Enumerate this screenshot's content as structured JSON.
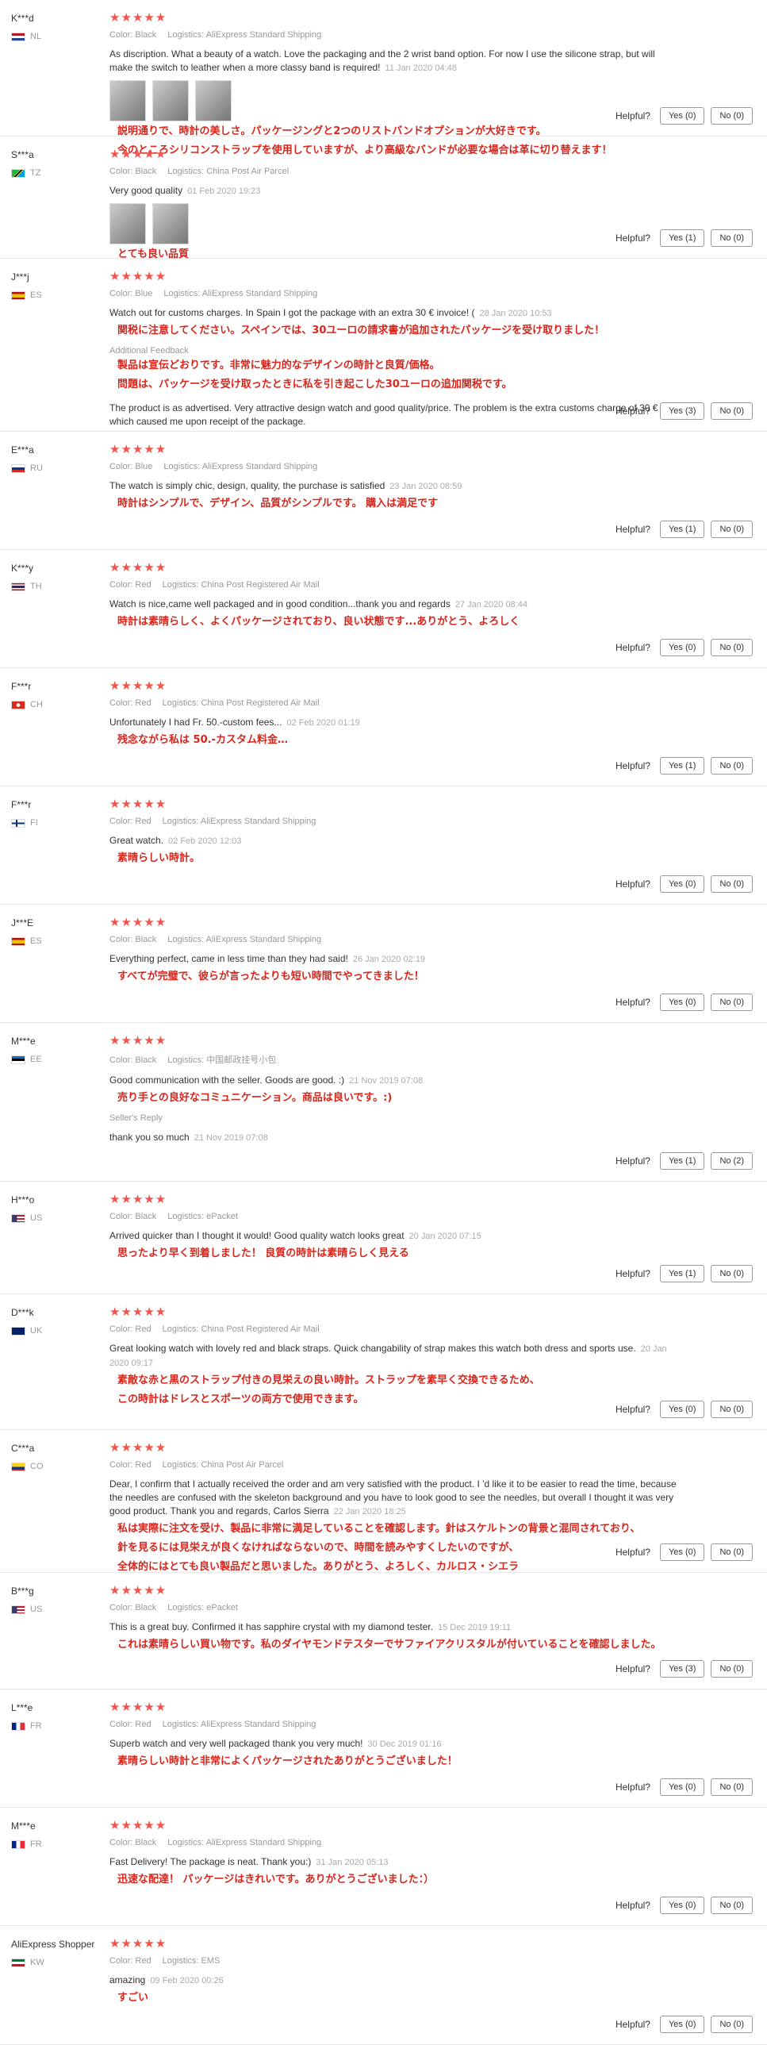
{
  "reviews": [
    {
      "user": "K***d",
      "country": "NL",
      "stars": "★★★★★",
      "color": "Color: Black",
      "logistics": "Logistics: AliExpress Standard Shipping",
      "text": "As discription. What a beauty of a watch. Love the packaging and the 2 wrist band option. For now I use the silicone strap, but will make the switch to leather when a more classy band is required!",
      "date": "11 Jan 2020 04:48",
      "jp": [
        "説明通りで、時計の美しさ。パッケージングと2つのリストバンドオプションが大好きです。",
        "今のところシリコンストラップを使用していますが、より高級なバンドが必要な場合は革に切り替えます！"
      ],
      "yes": "Yes (0)",
      "no": "No (0)"
    },
    {
      "user": "S***a",
      "country": "TZ",
      "stars": "★★★★★",
      "color": "Color: Black",
      "logistics": "Logistics: China Post Air Parcel",
      "text": "Very good quality",
      "date": "01 Feb 2020 19:23",
      "jp": [
        "とても良い品質"
      ],
      "yes": "Yes (1)",
      "no": "No (0)"
    },
    {
      "user": "J***j",
      "country": "ES",
      "stars": "★★★★★",
      "color": "Color: Blue",
      "logistics": "Logistics: AliExpress Standard Shipping",
      "text": "Watch out for customs charges. In Spain I got the package with an extra 30 € invoice! (",
      "date": "28 Jan 2020 10:53",
      "jp": [
        "関税に注意してください。スペインでは、30ユーロの請求書が追加されたパッケージを受け取りました！"
      ],
      "additional_label": "Additional Feedback",
      "additional_jp": [
        "製品は宣伝どおりです。非常に魅力的なデザインの時計と良質/価格。",
        "問題は、パッケージを受け取ったときに私を引き起こした30ユーロの追加関税です。"
      ],
      "additional_text": "The product is as advertised. Very attractive design watch and good quality/price. The problem is the extra customs charge of 30 € which caused me upon receipt of the package.",
      "yes": "Yes (3)",
      "no": "No (0)"
    },
    {
      "user": "E***a",
      "country": "RU",
      "stars": "★★★★★",
      "color": "Color: Blue",
      "logistics": "Logistics: AliExpress Standard Shipping",
      "text": "The watch is simply chic, design, quality, the purchase is satisfied",
      "date": "23 Jan 2020 08:59",
      "jp": [
        "時計はシンプルで、デザイン、品質がシンプルです。 購入は満足です"
      ],
      "yes": "Yes (1)",
      "no": "No (0)"
    },
    {
      "user": "K***y",
      "country": "TH",
      "stars": "★★★★★",
      "color": "Color: Red",
      "logistics": "Logistics: China Post Registered Air Mail",
      "text": "Watch is nice,came well packaged and in good condition...thank you and regards",
      "date": "27 Jan 2020 08:44",
      "jp": [
        "時計は素晴らしく、よくパッケージされており、良い状態です...ありがとう、よろしく"
      ],
      "yes": "Yes (0)",
      "no": "No (0)"
    },
    {
      "user": "F***r",
      "country": "CH",
      "stars": "★★★★★",
      "color": "Color: Red",
      "logistics": "Logistics: China Post Registered Air Mail",
      "text": "Unfortunately I had Fr. 50.-custom fees...",
      "date": "02 Feb 2020 01:19",
      "jp": [
        "残念ながら私は 50.-カスタム料金…"
      ],
      "yes": "Yes (1)",
      "no": "No (0)"
    },
    {
      "user": "F***r",
      "country": "FI",
      "stars": "★★★★★",
      "color": "Color: Red",
      "logistics": "Logistics: AliExpress Standard Shipping",
      "text": "Great watch.",
      "date": "02 Feb 2020 12:03",
      "jp": [
        "素晴らしい時計。"
      ],
      "yes": "Yes (0)",
      "no": "No (0)"
    },
    {
      "user": "J***E",
      "country": "ES",
      "stars": "★★★★★",
      "color": "Color: Black",
      "logistics": "Logistics: AliExpress Standard Shipping",
      "text": "Everything perfect, came in less time than they had said!",
      "date": "26 Jan 2020 02:19",
      "jp": [
        "すべてが完璧で、彼らが言ったよりも短い時間でやってきました！"
      ],
      "yes": "Yes (0)",
      "no": "No (0)"
    },
    {
      "user": "M***e",
      "country": "EE",
      "stars": "★★★★★",
      "color": "Color: Black",
      "logistics": "Logistics: 中国邮政挂号小包",
      "text": "Good communication with the seller. Goods are good. :)",
      "date": "21 Nov 2019 07:08",
      "jp": [
        "売り手との良好なコミュニケーション。商品は良いです。:)"
      ],
      "seller_label": "Seller's Reply",
      "seller_text": "thank you so much",
      "seller_date": "21 Nov 2019 07:08",
      "yes": "Yes (1)",
      "no": "No (2)"
    },
    {
      "user": "H***o",
      "country": "US",
      "stars": "★★★★★",
      "color": "Color: Black",
      "logistics": "Logistics: ePacket",
      "text": "Arrived quicker than I thought it would! Good quality watch looks great",
      "date": "20 Jan 2020 07:15",
      "jp": [
        "思ったより早く到着しました！ 良質の時計は素晴らしく見える"
      ],
      "yes": "Yes (1)",
      "no": "No (0)"
    },
    {
      "user": "D***k",
      "country": "UK",
      "stars": "★★★★★",
      "color": "Color: Red",
      "logistics": "Logistics: China Post Registered Air Mail",
      "text": "Great looking watch with lovely red and black straps. Quick changability of strap makes this watch both dress and sports use.",
      "date": "20 Jan 2020 09:17",
      "jp": [
        "素敵な赤と黒のストラップ付きの見栄えの良い時計。ストラップを素早く交換できるため、",
        "この時計はドレスとスポーツの両方で使用できます。"
      ],
      "yes": "Yes (0)",
      "no": "No (0)"
    },
    {
      "user": "C***a",
      "country": "CO",
      "stars": "★★★★★",
      "color": "Color: Red",
      "logistics": "Logistics: China Post Air Parcel",
      "text": "Dear, I confirm that I actually received the order and am very satisfied with the product. I 'd like it to be easier to read the time, because the needles are confused with the skeleton background and you have to look good to see the needles, but overall I thought it was very good product. Thank you and regards, Carlos Sierra",
      "date": "22 Jan 2020 18:25",
      "jp": [
        "私は実際に注文を受け、製品に非常に満足していることを確認します。針はスケルトンの背景と混同されており、",
        "針を見るには見栄えが良くなければならないので、時間を読みやすくしたいのですが、",
        "全体的にはとても良い製品だと思いました。ありがとう、よろしく、カルロス・シエラ"
      ],
      "yes": "Yes (0)",
      "no": "No (0)"
    },
    {
      "user": "B***g",
      "country": "US",
      "stars": "★★★★★",
      "color": "Color: Black",
      "logistics": "Logistics: ePacket",
      "text": "This is a great buy. Confirmed it has sapphire crystal with my diamond tester.",
      "date": "15 Dec 2019 19:11",
      "jp": [
        "これは素晴らしい買い物です。私のダイヤモンドテスターでサファイアクリスタルが付いていることを確認しました。"
      ],
      "yes": "Yes (3)",
      "no": "No (0)"
    },
    {
      "user": "L***e",
      "country": "FR",
      "stars": "★★★★★",
      "color": "Color: Red",
      "logistics": "Logistics: AliExpress Standard Shipping",
      "text": "Superb watch and very well packaged thank you very much!",
      "date": "30 Dec 2019 01:16",
      "jp": [
        "素晴らしい時計と非常によくパッケージされたありがとうございました！"
      ],
      "yes": "Yes (0)",
      "no": "No (0)"
    },
    {
      "user": "M***e",
      "country": "FR",
      "stars": "★★★★★",
      "color": "Color: Black",
      "logistics": "Logistics: AliExpress Standard Shipping",
      "text": "Fast Delivery! The package is neat. Thank you:)",
      "date": "31 Jan 2020 05:13",
      "jp": [
        "迅速な配達！ パッケージはきれいです。ありがとうございました：）"
      ],
      "yes": "Yes (0)",
      "no": "No (0)"
    },
    {
      "user": "AliExpress Shopper",
      "country": "KW",
      "stars": "★★★★★",
      "color": "Color: Red",
      "logistics": "Logistics: EMS",
      "text": "amazing",
      "date": "09 Feb 2020 00:26",
      "jp": [
        "すごい"
      ],
      "yes": "Yes (0)",
      "no": "No (0)"
    }
  ],
  "helpful_label": "Helpful?",
  "colors": {
    "star": "#f0544a",
    "jp_text": "#d9261c",
    "meta": "#999999"
  },
  "flags": {
    "NL": "linear-gradient(#ae1c28 0 33%,#fff 33% 66%,#21468b 66%)",
    "TZ": "linear-gradient(135deg,#1eb53a 0 40%,#fcd116 40% 45%,#000 45% 55%,#fcd116 55% 60%,#00a3dd 60%)",
    "ES": "linear-gradient(#aa151b 0 25%,#f1bf00 25% 75%,#aa151b 75%)",
    "RU": "linear-gradient(#fff 0 33%,#0039a6 33% 66%,#d52b1e 66%)",
    "TH": "linear-gradient(#a51931 0 16%,#fff 16% 33%,#2d2a4a 33% 66%,#fff 66% 83%,#a51931 83%)",
    "CH": "radial-gradient(circle,#fff 0 25%,#d52b1e 26%)",
    "FI": "linear-gradient(90deg,transparent 0 30%,#003580 30% 45%,transparent 45%),linear-gradient(#fff 0 40%,#003580 40% 60%,#fff 60%)",
    "EE": "linear-gradient(#0072ce 0 33%,#000 33% 66%,#fff 66%)",
    "US": "linear-gradient(90deg,#3c3b6e 0 40%,transparent 40%),repeating-linear-gradient(#b22234 0 2px,#fff 2px 4px)",
    "UK": "linear-gradient(#012169,#012169)",
    "CO": "linear-gradient(#fcd116 0 50%,#003893 50% 75%,#ce1126 75%)",
    "FR": "linear-gradient(90deg,#002395 0 33%,#fff 33% 66%,#ed2939 66%)",
    "KW": "linear-gradient(#007a3d 0 33%,#fff 33% 66%,#ce1126 66%)"
  }
}
